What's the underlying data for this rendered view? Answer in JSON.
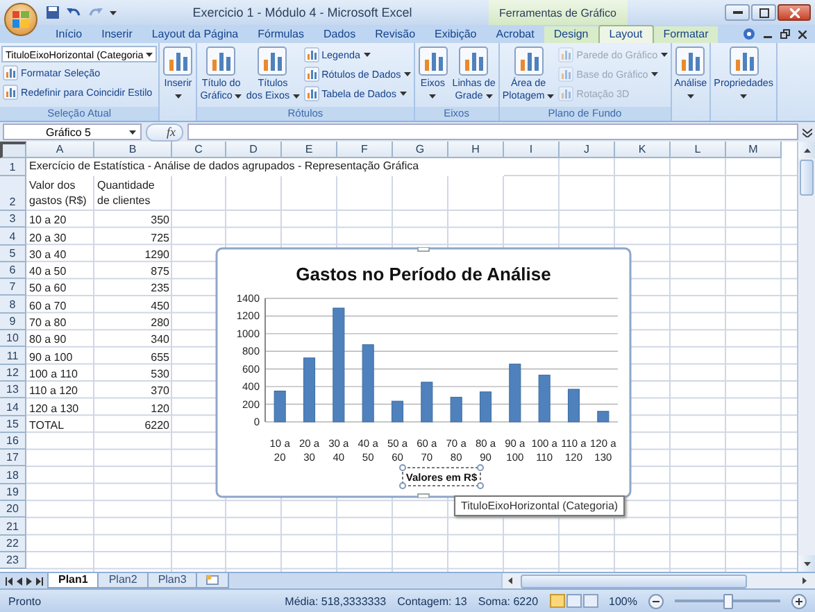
{
  "window": {
    "title": "Exercicio 1 - Módulo 4 - Microsoft Excel",
    "context_title": "Ferramentas de Gráfico"
  },
  "tabs": [
    {
      "label": "Início",
      "selected": false,
      "context": false
    },
    {
      "label": "Inserir",
      "selected": false,
      "context": false
    },
    {
      "label": "Layout da Página",
      "selected": false,
      "context": false
    },
    {
      "label": "Fórmulas",
      "selected": false,
      "context": false
    },
    {
      "label": "Dados",
      "selected": false,
      "context": false
    },
    {
      "label": "Revisão",
      "selected": false,
      "context": false
    },
    {
      "label": "Exibição",
      "selected": false,
      "context": false
    },
    {
      "label": "Acrobat",
      "selected": false,
      "context": false
    },
    {
      "label": "Design",
      "selected": false,
      "context": true
    },
    {
      "label": "Layout",
      "selected": true,
      "context": true
    },
    {
      "label": "Formatar",
      "selected": false,
      "context": true
    }
  ],
  "ribbon": {
    "groups": [
      {
        "label": "Seleção Atual",
        "items": [
          {
            "kind": "combo",
            "label": "TituloEixoHorizontal (Categoria"
          },
          {
            "kind": "small",
            "label": "Formatar Seleção",
            "disabled": false,
            "dropdown": false
          },
          {
            "kind": "small",
            "label": "Redefinir para Coincidir Estilo",
            "disabled": false,
            "dropdown": false
          }
        ]
      },
      {
        "items": [
          {
            "kind": "large",
            "lines": [
              "Inserir"
            ],
            "dropdown": true
          }
        ]
      },
      {
        "label": "Rótulos",
        "items": [
          {
            "kind": "large",
            "lines": [
              "Título do",
              "Gráfico"
            ],
            "dropdown": true
          },
          {
            "kind": "large",
            "lines": [
              "Títulos",
              "dos Eixos"
            ],
            "dropdown": true
          },
          {
            "kind": "small",
            "label": "Legenda",
            "disabled": false,
            "dropdown": true
          },
          {
            "kind": "small",
            "label": "Rótulos de Dados",
            "disabled": false,
            "dropdown": true
          },
          {
            "kind": "small",
            "label": "Tabela de Dados",
            "disabled": false,
            "dropdown": true
          }
        ]
      },
      {
        "label": "Eixos",
        "items": [
          {
            "kind": "large",
            "lines": [
              "Eixos"
            ],
            "dropdown": true
          },
          {
            "kind": "large",
            "lines": [
              "Linhas de",
              "Grade"
            ],
            "dropdown": true
          }
        ]
      },
      {
        "label": "Plano de Fundo",
        "items": [
          {
            "kind": "large",
            "lines": [
              "Área de",
              "Plotagem"
            ],
            "dropdown": true
          },
          {
            "kind": "small",
            "label": "Parede do Gráfico",
            "disabled": true,
            "dropdown": true
          },
          {
            "kind": "small",
            "label": "Base do Gráfico",
            "disabled": true,
            "dropdown": true
          },
          {
            "kind": "small",
            "label": "Rotação 3D",
            "disabled": true,
            "dropdown": false
          }
        ]
      },
      {
        "items": [
          {
            "kind": "large",
            "lines": [
              "Análise"
            ],
            "dropdown": true
          }
        ]
      },
      {
        "items": [
          {
            "kind": "large",
            "lines": [
              "Propriedades"
            ],
            "dropdown": true
          }
        ]
      }
    ]
  },
  "formula_bar": {
    "name_box": "Gráfico 5",
    "fx_label": "fx"
  },
  "sheet": {
    "columns": [
      "A",
      "B",
      "C",
      "D",
      "E",
      "F",
      "G",
      "H",
      "I",
      "J",
      "K",
      "L",
      "M"
    ],
    "rows": [
      {
        "number": "1",
        "kind": "title",
        "cells": [
          "Exercício de Estatística - Análise de dados agrupados - Representação Gráfica"
        ]
      },
      {
        "number": "2",
        "kind": "header",
        "cells": [
          "Valor dos gastos (R$)",
          "Quantidade de clientes"
        ]
      },
      {
        "number": "3",
        "kind": "data",
        "cells": [
          "10 a 20",
          "350"
        ]
      },
      {
        "number": "4",
        "kind": "data",
        "cells": [
          "20 a 30",
          "725"
        ]
      },
      {
        "number": "5",
        "kind": "data",
        "cells": [
          "30 a 40",
          "1290"
        ]
      },
      {
        "number": "6",
        "kind": "data",
        "cells": [
          "40 a 50",
          "875"
        ]
      },
      {
        "number": "7",
        "kind": "data",
        "cells": [
          "50 a 60",
          "235"
        ]
      },
      {
        "number": "8",
        "kind": "data",
        "cells": [
          "60 a 70",
          "450"
        ]
      },
      {
        "number": "9",
        "kind": "data",
        "cells": [
          "70 a 80",
          "280"
        ]
      },
      {
        "number": "10",
        "kind": "data",
        "cells": [
          "80 a 90",
          "340"
        ]
      },
      {
        "number": "11",
        "kind": "data",
        "cells": [
          "90 a 100",
          "655"
        ]
      },
      {
        "number": "12",
        "kind": "data",
        "cells": [
          "100 a 110",
          "530"
        ]
      },
      {
        "number": "13",
        "kind": "data",
        "cells": [
          "110 a 120",
          "370"
        ]
      },
      {
        "number": "14",
        "kind": "data",
        "cells": [
          "120 a 130",
          "120"
        ]
      },
      {
        "number": "15",
        "kind": "data",
        "cells": [
          "TOTAL",
          "6220"
        ]
      },
      {
        "number": "16",
        "kind": "empty"
      },
      {
        "number": "17",
        "kind": "empty"
      },
      {
        "number": "18",
        "kind": "empty"
      },
      {
        "number": "19",
        "kind": "empty"
      },
      {
        "number": "20",
        "kind": "empty"
      },
      {
        "number": "21",
        "kind": "empty"
      },
      {
        "number": "22",
        "kind": "empty"
      },
      {
        "number": "23",
        "kind": "empty"
      }
    ]
  },
  "chart": {
    "tooltip": "TituloEixoHorizontal (Categoria)",
    "chart_data": {
      "type": "bar",
      "title": "Gastos no Período de Análise",
      "xlabel": "Valores em R$",
      "grid": true,
      "categories": [
        "10 a 20",
        "20 a 30",
        "30 a 40",
        "40 a 50",
        "50 a 60",
        "60 a 70",
        "70 a 80",
        "80 a 90",
        "90 a 100",
        "100 a 110",
        "110 a 120",
        "120 a 130"
      ],
      "series": [
        {
          "color": "#4f81bd",
          "values": [
            350,
            725,
            1290,
            875,
            235,
            450,
            280,
            340,
            655,
            530,
            370,
            120
          ]
        }
      ],
      "ylim": [
        0,
        1400
      ],
      "yticks": [
        0,
        200,
        400,
        600,
        800,
        1000,
        1200,
        1400
      ]
    }
  },
  "sheet_tabs": [
    {
      "label": "Plan1",
      "selected": true
    },
    {
      "label": "Plan2",
      "selected": false
    },
    {
      "label": "Plan3",
      "selected": false
    }
  ],
  "status_bar": {
    "mode": "Pronto",
    "average": "Média: 518,3333333",
    "count": "Contagem: 13",
    "sum": "Soma: 6220",
    "views": [
      {
        "selected": true
      },
      {
        "selected": false
      },
      {
        "selected": false
      }
    ],
    "zoom": "100%",
    "zoom_slider": {
      "level": 0.5
    }
  }
}
